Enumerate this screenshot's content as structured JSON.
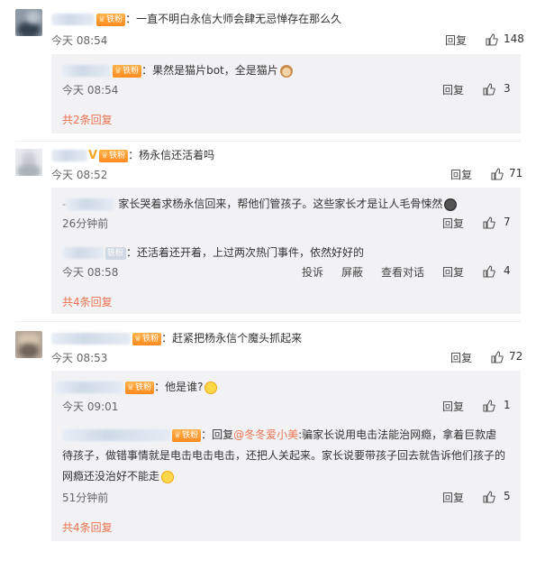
{
  "badge_label": "铁粉",
  "comments": [
    {
      "text": "：一直不明白永信大师会肆无忌惮存在那么久",
      "time": "今天 08:54",
      "reply": "回复",
      "likes": "148",
      "replies": [
        {
          "text": "：果然是猫片bot，全是猫片",
          "time": "今天 08:54",
          "reply": "回复",
          "likes": "3"
        }
      ],
      "more": "共2条回复"
    },
    {
      "text": "：杨永信还活着吗",
      "time": "今天 08:52",
      "reply": "回复",
      "likes": "71",
      "replies": [
        {
          "text": "家长哭着求杨永信回来，帮他们管孩子。这些家长才是让人毛骨悚然",
          "time": "26分钟前",
          "reply": "回复",
          "likes": "7"
        },
        {
          "text": "：还活着还开着，上过两次热门事件，依然好好的",
          "time": "今天 08:58",
          "reply": "回复",
          "likes": "4",
          "extra_actions": [
            "投诉",
            "屏蔽",
            "查看对话"
          ]
        }
      ],
      "more": "共4条回复"
    },
    {
      "text": "：赶紧把杨永信个魔头抓起来",
      "time": "今天 08:53",
      "reply": "回复",
      "likes": "72",
      "replies": [
        {
          "text": "：他是谁?",
          "time": "今天 09:01",
          "reply": "回复",
          "likes": "1"
        },
        {
          "prefix": "：回复",
          "mention": "@冬冬爱小美",
          "text_line1": ":骗家长说用电击法能治网瘾，拿着巨款虐",
          "text_line2": "待孩子，做错事情就是电击电击电击，还把人关起来。家长说要带孩子回去就告诉他们孩子的",
          "text_line3": "网瘾还没治好不能走",
          "time": "51分钟前",
          "reply": "回复",
          "likes": "5"
        }
      ],
      "more": "共4条回复"
    }
  ],
  "colors": {
    "accent": "#eb7350",
    "badge": "#ff8a1e",
    "sub_bg": "#f2f2f5"
  }
}
